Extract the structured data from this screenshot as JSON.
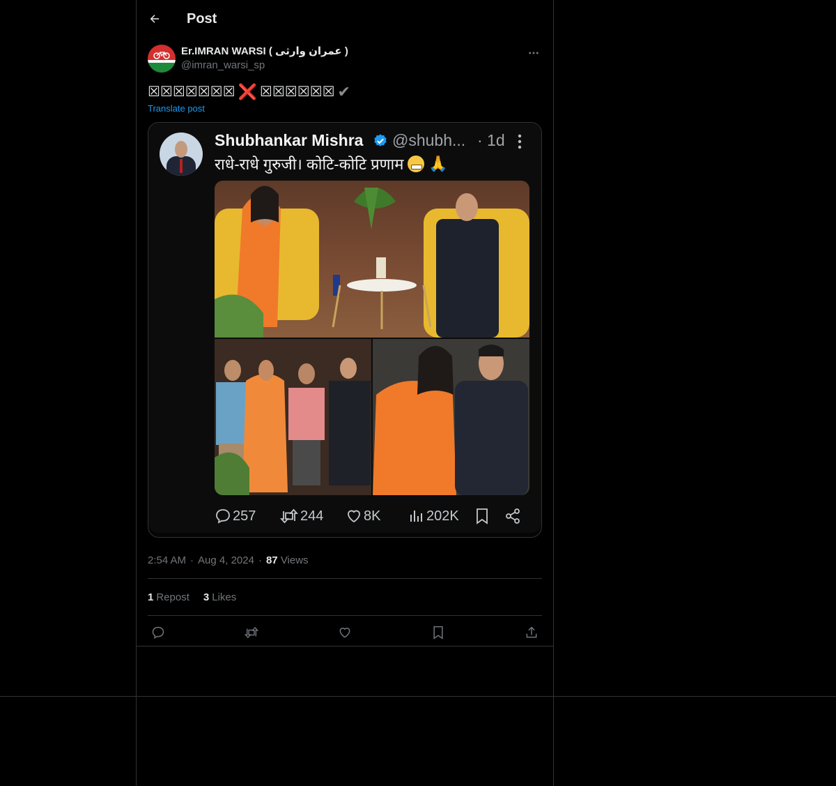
{
  "header": {
    "title": "Post"
  },
  "post": {
    "author": {
      "display_name": "Er.IMRAN WARSI ( عمران وارثی )",
      "handle": "@imran_warsi_sp"
    },
    "text_part1": "☒☒☒☒☒☒☒",
    "x_mark": "❌",
    "text_part2": "☒☒☒☒☒☒",
    "check_mark": "✔",
    "translate": "Translate post",
    "embedded": {
      "name": "Shubhankar Mishra",
      "handle": "@shubh...",
      "time": "· 1d",
      "text": "राधे-राधे गुरुजी। कोटि-कोटि प्रणाम",
      "stats": {
        "replies": "257",
        "reposts": "244",
        "likes": "8K",
        "views": "202K"
      }
    },
    "meta": {
      "time": "2:54 AM",
      "date": "Aug 4, 2024",
      "views_count": "87",
      "views_label": "Views"
    },
    "engagement": {
      "repost_count": "1",
      "repost_label": "Repost",
      "likes_count": "3",
      "likes_label": "Likes"
    }
  },
  "colors": {
    "background": "#000000",
    "border": "#2f3336",
    "accent": "#1d9bf0",
    "muted": "#71767b"
  }
}
